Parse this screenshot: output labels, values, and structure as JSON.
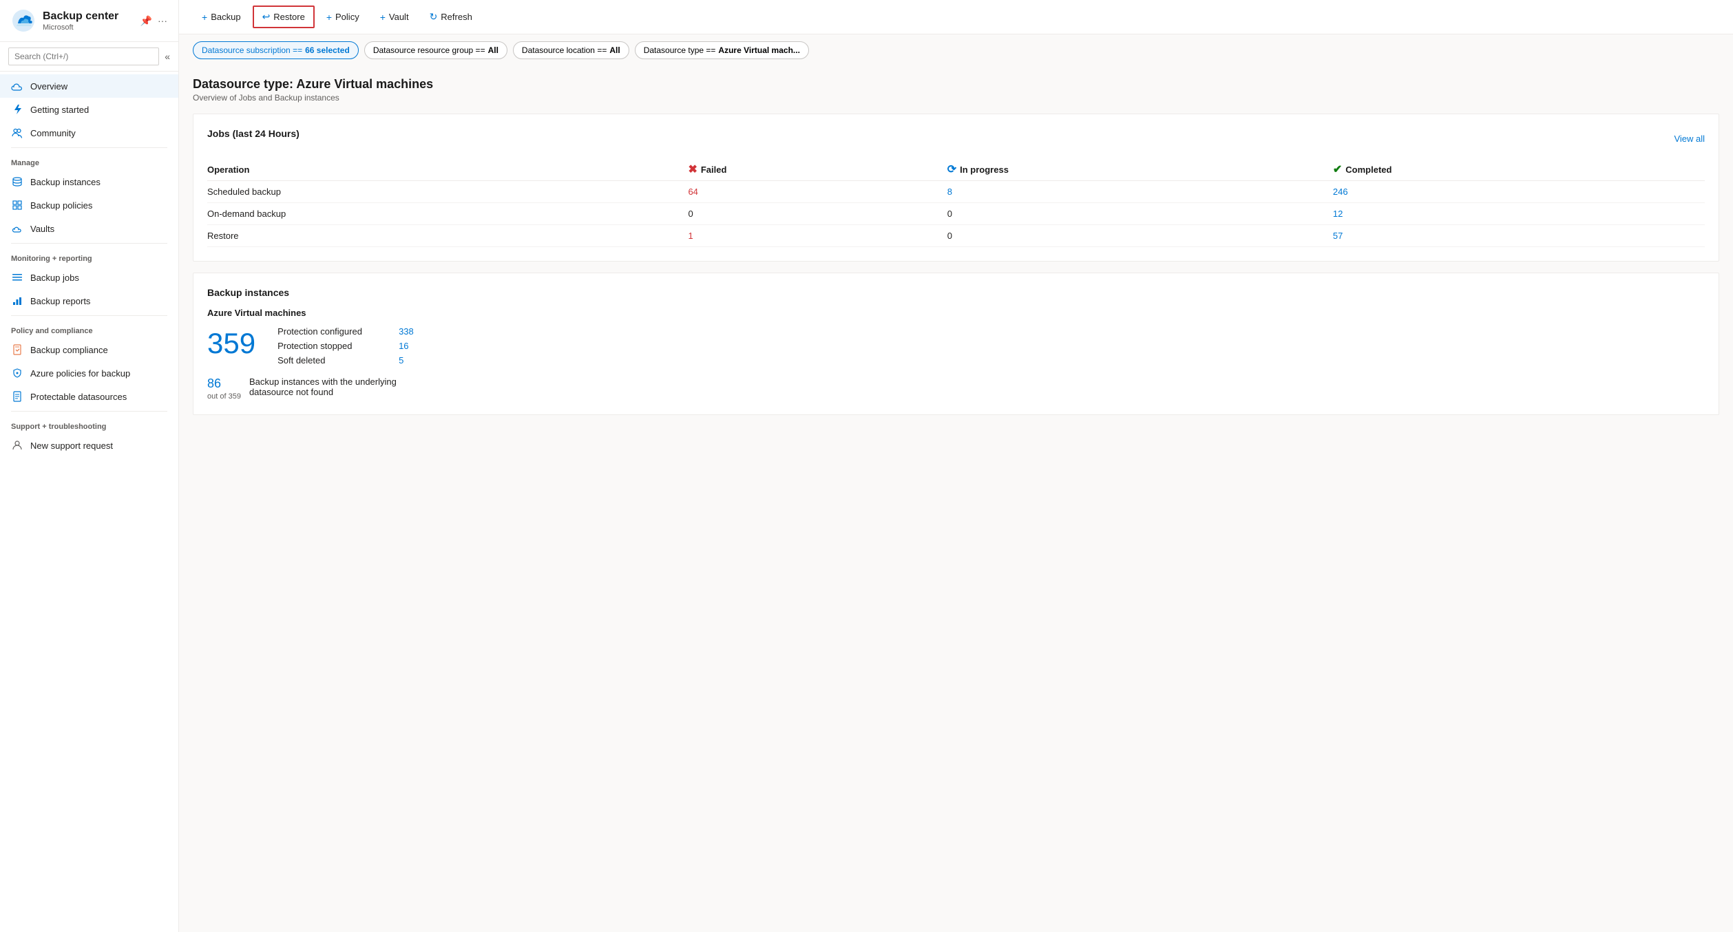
{
  "app": {
    "title": "Backup center",
    "subtitle": "Microsoft"
  },
  "sidebar": {
    "search_placeholder": "Search (Ctrl+/)",
    "nav_items": [
      {
        "id": "overview",
        "label": "Overview",
        "icon": "cloud",
        "active": true
      },
      {
        "id": "getting-started",
        "label": "Getting started",
        "icon": "lightning"
      },
      {
        "id": "community",
        "label": "Community",
        "icon": "people"
      }
    ],
    "sections": [
      {
        "label": "Manage",
        "items": [
          {
            "id": "backup-instances",
            "label": "Backup instances",
            "icon": "database"
          },
          {
            "id": "backup-policies",
            "label": "Backup policies",
            "icon": "grid"
          },
          {
            "id": "vaults",
            "label": "Vaults",
            "icon": "cloud-store"
          }
        ]
      },
      {
        "label": "Monitoring + reporting",
        "items": [
          {
            "id": "backup-jobs",
            "label": "Backup jobs",
            "icon": "list"
          },
          {
            "id": "backup-reports",
            "label": "Backup reports",
            "icon": "chart"
          }
        ]
      },
      {
        "label": "Policy and compliance",
        "items": [
          {
            "id": "backup-compliance",
            "label": "Backup compliance",
            "icon": "doc-check"
          },
          {
            "id": "azure-policies",
            "label": "Azure policies for backup",
            "icon": "shield-settings"
          },
          {
            "id": "protectable-datasources",
            "label": "Protectable datasources",
            "icon": "doc-list"
          }
        ]
      },
      {
        "label": "Support + troubleshooting",
        "items": [
          {
            "id": "new-support",
            "label": "New support request",
            "icon": "person-support"
          }
        ]
      }
    ]
  },
  "toolbar": {
    "buttons": [
      {
        "id": "backup",
        "label": "Backup",
        "icon": "+",
        "highlighted": false
      },
      {
        "id": "restore",
        "label": "Restore",
        "icon": "↩",
        "highlighted": true
      },
      {
        "id": "policy",
        "label": "Policy",
        "icon": "+",
        "highlighted": false
      },
      {
        "id": "vault",
        "label": "Vault",
        "icon": "+",
        "highlighted": false
      },
      {
        "id": "refresh",
        "label": "Refresh",
        "icon": "↻",
        "highlighted": false
      }
    ]
  },
  "filters": [
    {
      "id": "datasource-subscription",
      "label": "Datasource subscription == ",
      "value": "66 selected",
      "active": true
    },
    {
      "id": "datasource-resource-group",
      "label": "Datasource resource group == ",
      "value": "All",
      "active": false
    },
    {
      "id": "datasource-location",
      "label": "Datasource location == ",
      "value": "All",
      "active": false
    },
    {
      "id": "datasource-type",
      "label": "Datasource type == ",
      "value": "Azure Virtual mach...",
      "active": false
    }
  ],
  "main": {
    "page_title": "Datasource type: Azure Virtual machines",
    "page_subtitle": "Overview of Jobs and Backup instances",
    "jobs_card": {
      "title": "Jobs (last 24 Hours)",
      "view_all": "View all",
      "columns": [
        "Operation",
        "Failed",
        "In progress",
        "Completed"
      ],
      "status_labels": {
        "failed": "Failed",
        "in_progress": "In progress",
        "completed": "Completed"
      },
      "rows": [
        {
          "operation": "Scheduled backup",
          "failed": "64",
          "in_progress": "8",
          "completed": "246"
        },
        {
          "operation": "On-demand backup",
          "failed": "0",
          "in_progress": "0",
          "completed": "12"
        },
        {
          "operation": "Restore",
          "failed": "1",
          "in_progress": "0",
          "completed": "57"
        }
      ]
    },
    "backup_instances_card": {
      "title": "Backup instances",
      "vm_label": "Azure Virtual machines",
      "total": "359",
      "stats": [
        {
          "label": "Protection configured",
          "value": "338"
        },
        {
          "label": "Protection stopped",
          "value": "16"
        },
        {
          "label": "Soft deleted",
          "value": "5"
        }
      ],
      "footer_num": "86",
      "footer_of": "out of 359",
      "footer_desc": "Backup instances with the underlying datasource not found"
    }
  }
}
